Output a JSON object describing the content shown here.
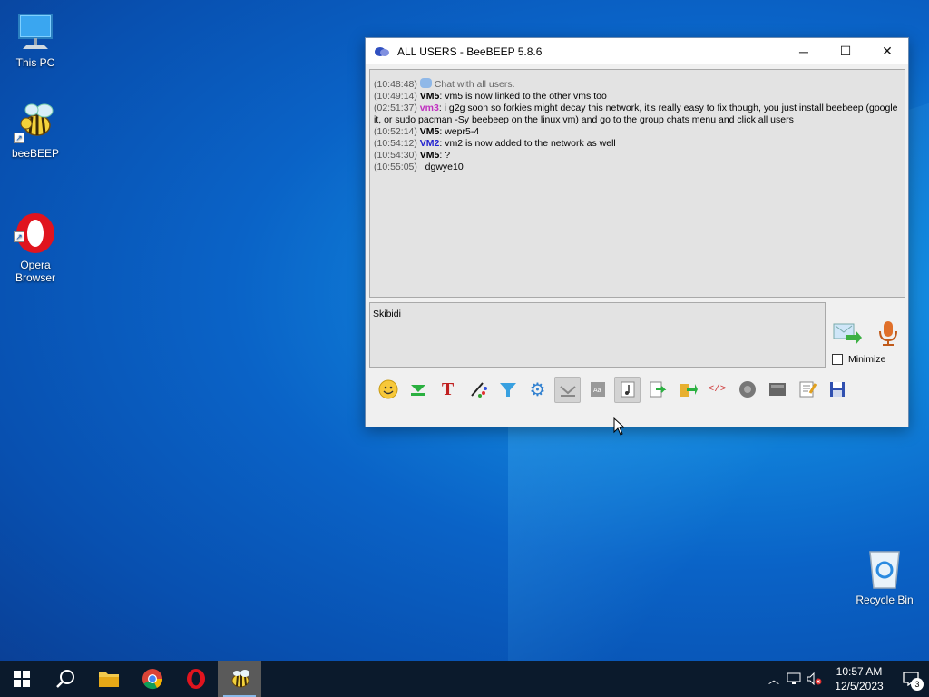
{
  "desktop": {
    "icons": [
      {
        "label": "This PC"
      },
      {
        "label": "beeBEEP"
      },
      {
        "label": "Opera\nBrowser"
      },
      {
        "label": "Recycle Bin"
      }
    ]
  },
  "window": {
    "title": "ALL USERS - BeeBEEP 5.8.6",
    "chat": [
      {
        "ts": "(10:48:48)",
        "name": "",
        "text": "Chat with all users.",
        "kind": "system"
      },
      {
        "ts": "(10:49:14)",
        "name": "VM5",
        "text": ": vm5 is now linked to the other vms too",
        "kind": "vm5"
      },
      {
        "ts": "(02:51:37)",
        "name": "vm3",
        "text": ": i g2g soon so forkies might decay this network, it's really easy to fix though, you just install beebeep (google it, or sudo pacman -Sy beebeep on the linux vm) and go to the group chats menu and click all users",
        "kind": "vm3"
      },
      {
        "ts": "(10:52:14)",
        "name": "VM5",
        "text": ": wepr5-4",
        "kind": "vm5"
      },
      {
        "ts": "(10:54:12)",
        "name": "VM2",
        "text": ": vm2 is now added to the network as well",
        "kind": "vm2"
      },
      {
        "ts": "(10:54:30)",
        "name": "VM5",
        "text": ": ?",
        "kind": "vm5"
      },
      {
        "ts": "(10:55:05)",
        "name": "",
        "text": "dgwye10",
        "kind": "plain"
      }
    ],
    "input_value": "Skibidi",
    "minimize_label": "Minimize",
    "toolbar_icons": [
      "emoticon-icon",
      "download-icon",
      "font-icon",
      "color-picker-icon",
      "filter-icon",
      "settings-gear-icon",
      "compact-view-icon",
      "font-size-icon",
      "music-note-icon",
      "export-icon",
      "send-file-icon",
      "code-icon",
      "record-icon",
      "screenshot-icon",
      "notes-icon",
      "save-icon"
    ]
  },
  "taskbar": {
    "time": "10:57 AM",
    "date": "12/5/2023",
    "notifications": "3"
  }
}
